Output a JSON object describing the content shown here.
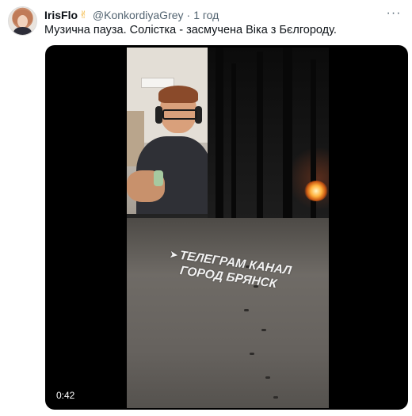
{
  "tweet": {
    "display_name": "IrisFlo",
    "name_emoji": "✌",
    "handle": "@KonkordiyaGrey",
    "separator": "·",
    "time": "1 год",
    "text": "Музична пауза. Солістка - засмучена Віка з Бєлгороду."
  },
  "menu": {
    "more_icon": "more-dots-icon",
    "glyph": "···"
  },
  "media": {
    "overlay_line1": "ТЕЛЕГРАМ КАНАЛ",
    "overlay_line2": "ГОРОД БРЯНСК",
    "plane_glyph": "➤",
    "duration": "0:42"
  }
}
